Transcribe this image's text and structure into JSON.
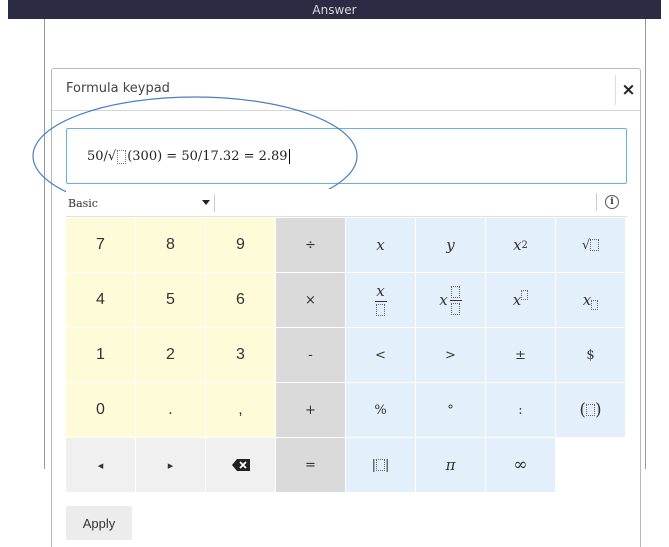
{
  "page": {
    "answer_title": "Answer"
  },
  "dialog": {
    "title": "Formula keypad",
    "close_label": "×",
    "formula": {
      "prefix": "50/√",
      "suffix": "(300) = 50/17.32 = 2.89"
    },
    "mode": "Basic",
    "info_label": "i",
    "apply_label": "Apply"
  },
  "keypad": {
    "r1": [
      "7",
      "8",
      "9",
      "÷",
      "x",
      "y"
    ],
    "r2": [
      "4",
      "5",
      "6",
      "×",
      "x",
      "x"
    ],
    "r3": [
      "1",
      "2",
      "3",
      "-",
      "<",
      ">",
      "±",
      "$"
    ],
    "r4": [
      "0",
      ".",
      ",",
      "+",
      "%",
      "°",
      ":"
    ],
    "r5": [
      "◂",
      "▸",
      "=",
      "π",
      "∞"
    ],
    "superscript_2": "2",
    "paren_open": "(",
    "paren_close": ")",
    "sqrt": "√",
    "abs": "|"
  },
  "colors": {
    "number_keys": "#fdfbd8",
    "operator_keys": "#dadada",
    "function_keys": "#e3f0fb",
    "annotation_oval": "#4a7fc1"
  }
}
